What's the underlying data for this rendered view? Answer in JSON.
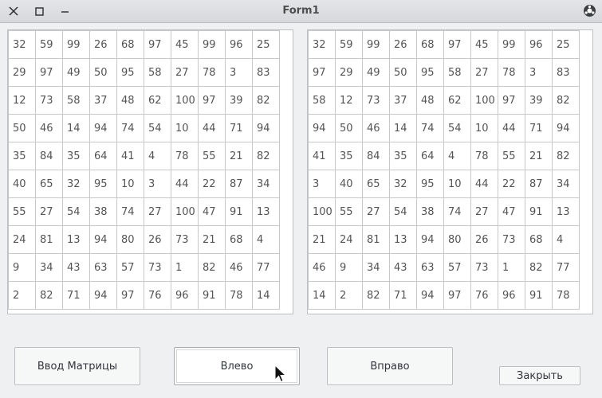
{
  "window": {
    "title": "Form1"
  },
  "left_matrix": [
    [
      "32",
      "59",
      "99",
      "26",
      "68",
      "97",
      "45",
      "99",
      "96",
      "25"
    ],
    [
      "29",
      "97",
      "49",
      "50",
      "95",
      "58",
      "27",
      "78",
      "3",
      "83"
    ],
    [
      "12",
      "73",
      "58",
      "37",
      "48",
      "62",
      "100",
      "97",
      "39",
      "82"
    ],
    [
      "50",
      "46",
      "14",
      "94",
      "74",
      "54",
      "10",
      "44",
      "71",
      "94"
    ],
    [
      "35",
      "84",
      "35",
      "64",
      "41",
      "4",
      "78",
      "55",
      "21",
      "82"
    ],
    [
      "40",
      "65",
      "32",
      "95",
      "10",
      "3",
      "44",
      "22",
      "87",
      "34"
    ],
    [
      "55",
      "27",
      "54",
      "38",
      "74",
      "27",
      "100",
      "47",
      "91",
      "13"
    ],
    [
      "24",
      "81",
      "13",
      "94",
      "80",
      "26",
      "73",
      "21",
      "68",
      "4"
    ],
    [
      "9",
      "34",
      "43",
      "63",
      "57",
      "73",
      "1",
      "82",
      "46",
      "77"
    ],
    [
      "2",
      "82",
      "71",
      "94",
      "97",
      "76",
      "96",
      "91",
      "78",
      "14"
    ]
  ],
  "right_matrix": [
    [
      "32",
      "59",
      "99",
      "26",
      "68",
      "97",
      "45",
      "99",
      "96",
      "25"
    ],
    [
      "97",
      "29",
      "49",
      "50",
      "95",
      "58",
      "27",
      "78",
      "3",
      "83"
    ],
    [
      "58",
      "12",
      "73",
      "37",
      "48",
      "62",
      "100",
      "97",
      "39",
      "82"
    ],
    [
      "94",
      "50",
      "46",
      "14",
      "74",
      "54",
      "10",
      "44",
      "71",
      "94"
    ],
    [
      "41",
      "35",
      "84",
      "35",
      "64",
      "4",
      "78",
      "55",
      "21",
      "82"
    ],
    [
      "3",
      "40",
      "65",
      "32",
      "95",
      "10",
      "44",
      "22",
      "87",
      "34"
    ],
    [
      "100",
      "55",
      "27",
      "54",
      "38",
      "74",
      "27",
      "47",
      "91",
      "13"
    ],
    [
      "21",
      "24",
      "81",
      "13",
      "94",
      "80",
      "26",
      "73",
      "68",
      "4"
    ],
    [
      "46",
      "9",
      "34",
      "43",
      "63",
      "57",
      "73",
      "1",
      "82",
      "77"
    ],
    [
      "14",
      "2",
      "82",
      "71",
      "94",
      "97",
      "76",
      "96",
      "91",
      "78"
    ]
  ],
  "buttons": {
    "input_matrix": "Ввод Матрицы",
    "left": "Влево",
    "right": "Вправо",
    "close": "Закрыть"
  },
  "icons": {
    "close": "close-icon",
    "maximize": "maximize-icon",
    "minimize": "minimize-icon",
    "app": "app-icon",
    "cursor": "mouse-pointer"
  }
}
